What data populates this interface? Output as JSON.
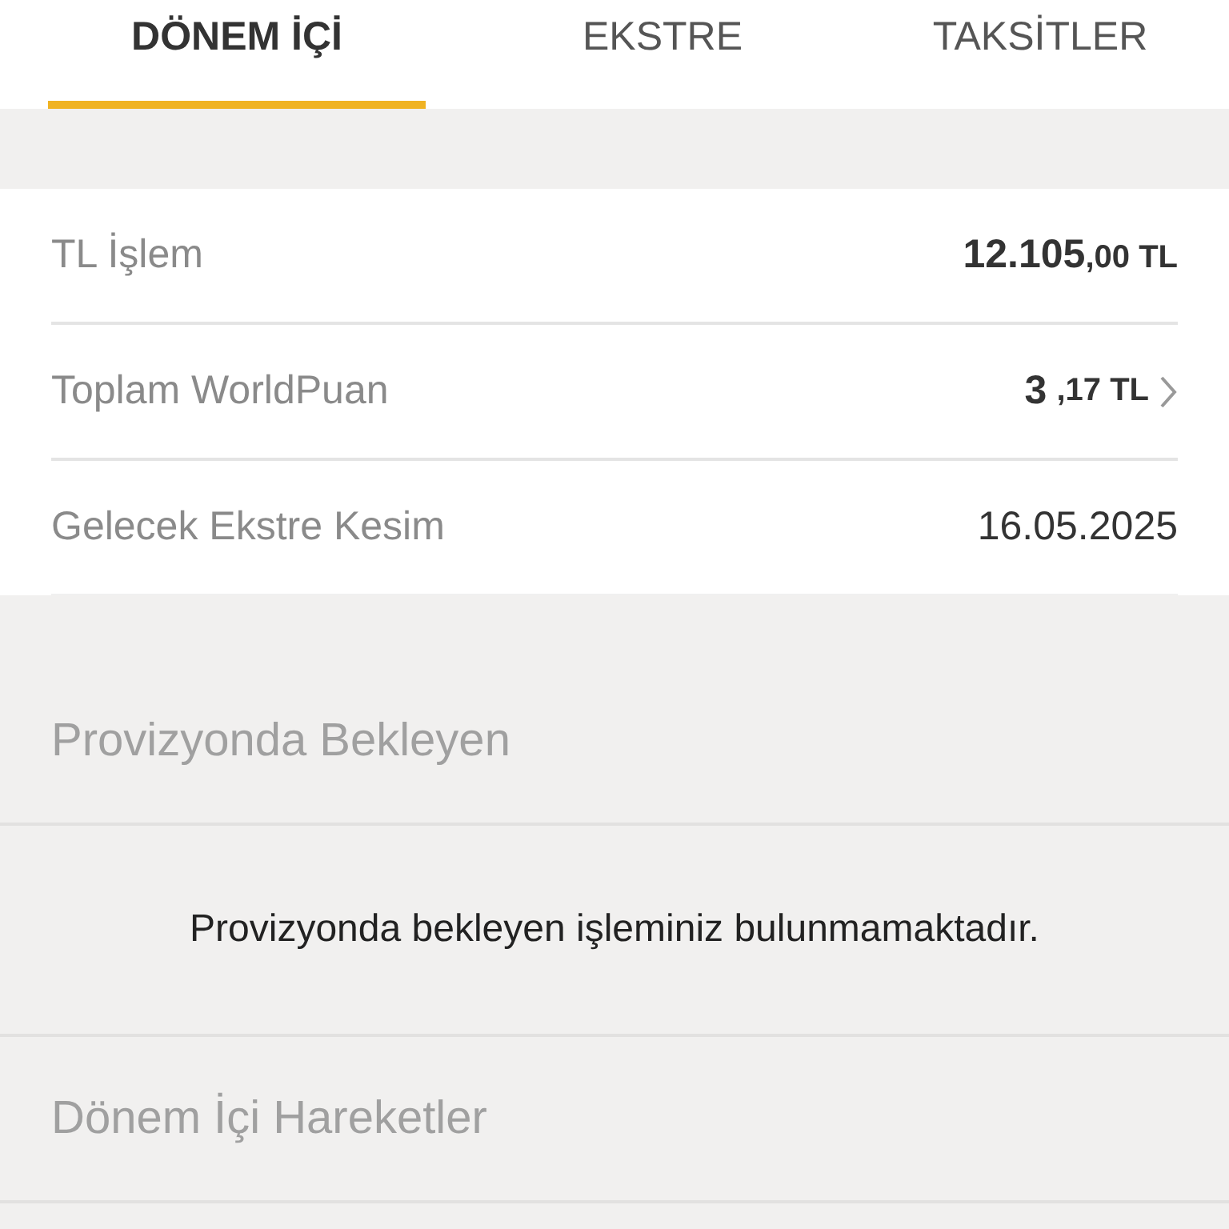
{
  "tabs": [
    {
      "label": "DÖNEM İÇİ",
      "selected": true
    },
    {
      "label": "EKSTRE",
      "selected": false
    },
    {
      "label": "TAKSİTLER",
      "selected": false
    }
  ],
  "summary": [
    {
      "kind": "amount",
      "label": "TL İşlem",
      "whole": "12.105",
      "fraction": ",00 TL"
    },
    {
      "kind": "link",
      "label": "Toplam WorldPuan",
      "whole": "3",
      "fraction": ",17 TL"
    },
    {
      "kind": "plain",
      "label": "Gelecek Ekstre Kesim",
      "value": "16.05.2025"
    }
  ],
  "pending": {
    "title": "Provizyonda Bekleyen",
    "message": "Provizyonda bekleyen işleminiz bulunmamaktadır."
  },
  "movements": {
    "title": "Dönem İçi Hareketler"
  }
}
